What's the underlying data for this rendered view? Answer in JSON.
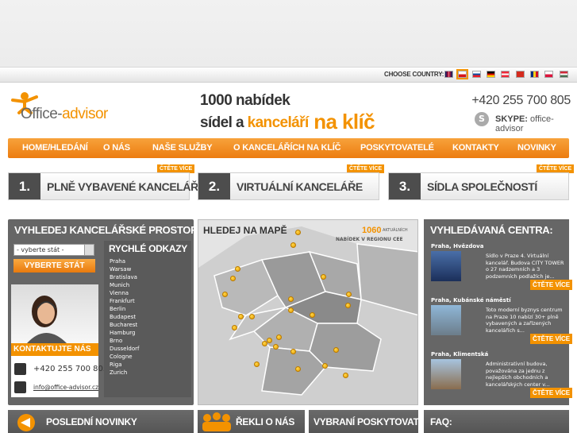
{
  "colors": {
    "accent": "#f39200",
    "panel": "#666666",
    "dark": "#4d4d4d"
  },
  "country_bar": {
    "label": "CHOOSE COUNTRY:",
    "flags": [
      "gb-flag-icon",
      "cz-flag-icon",
      "sk-flag-icon",
      "de-flag-icon",
      "at-flag-icon",
      "ch-flag-icon",
      "ro-flag-icon",
      "pl-flag-icon",
      "hu-flag-icon"
    ]
  },
  "header": {
    "logo_office": "Office-",
    "logo_advisor": "advisor",
    "slogan_line1": "1000 nabídek",
    "slogan_line2a": "sídel a ",
    "slogan_line2b": "kanceláří",
    "slogan_line2c": " na klíč",
    "phone": "+420 255 700 805",
    "skype_label": "SKYPE:",
    "skype_value": " office-advisor"
  },
  "nav": [
    "HOME/HLEDÁNÍ",
    "O NÁS",
    "NAŠE SLUŽBY",
    "O KANCELÁŘÍCH NA KLÍČ",
    "POSKYTOVATELÉ",
    "KONTAKTY",
    "NOVINKY"
  ],
  "tiles": [
    {
      "num": "1.",
      "title": "PLNĚ VYBAVENÉ KANCELÁŘE",
      "more": "ČTĚTE VÍCE"
    },
    {
      "num": "2.",
      "title": "VIRTUÁLNÍ KANCELÁŘE",
      "more": "ČTĚTE VÍCE"
    },
    {
      "num": "3.",
      "title": "SÍDLA SPOLEČNOSTÍ",
      "more": "ČTĚTE VÍCE"
    }
  ],
  "search_panel": {
    "title": "VYHLEDEJ KANCELÁŘSKÉ PROSTORY:",
    "select_value": "- vyberte stát -",
    "button": "VYBERTE STÁT",
    "contact_title": "KONTAKTUJTE NÁS",
    "phone": "+420 255 700 805",
    "email": "info@office-advisor.cz"
  },
  "quick_links": {
    "title": "RYCHLÉ ODKAZY",
    "items": [
      "Praha",
      "Warsaw",
      "Bratislava",
      "Munich",
      "Vienna",
      "Frankfurt",
      "Berlin",
      "Budapest",
      "Bucharest",
      "Hamburg",
      "Brno",
      "Dusseldorf",
      "Cologne",
      "Riga",
      "Zurich"
    ]
  },
  "map": {
    "title": "HLEDEJ NA MAPĚ",
    "count": "1060",
    "count_small": "AKTUÁLNÍCH",
    "subtitle": "NABÍDEK V REGIONU CEE"
  },
  "centers": {
    "title": "VYHLEDÁVANÁ CENTRA:",
    "items": [
      {
        "name": "Praha, Hvězdova",
        "desc": "Sídlo v Praze 4. Virtuální kancelář. Budova CITY TOWER o 27 nadzemních a 3 podzemních podlažích je...",
        "more": "ČTĚTE VÍCE"
      },
      {
        "name": "Praha, Kubánské náměstí",
        "desc": "Toto moderní byznys centrum na Praze 10 nabízí 30+ plně vybavených a zařízených kancelářích s...",
        "more": "ČTĚTE VÍCE"
      },
      {
        "name": "Praha, Klimentská",
        "desc": "Administrativní budova, považována za jednu z nejlepších obchodních a kancelářských center v...",
        "more": "ČTĚTE VÍCE"
      }
    ]
  },
  "bottom": [
    "POSLEDNÍ NOVINKY",
    "ŘEKLI O NÁS",
    "VYBRANÍ POSKYTOVATELÉ",
    "FAQ:"
  ]
}
